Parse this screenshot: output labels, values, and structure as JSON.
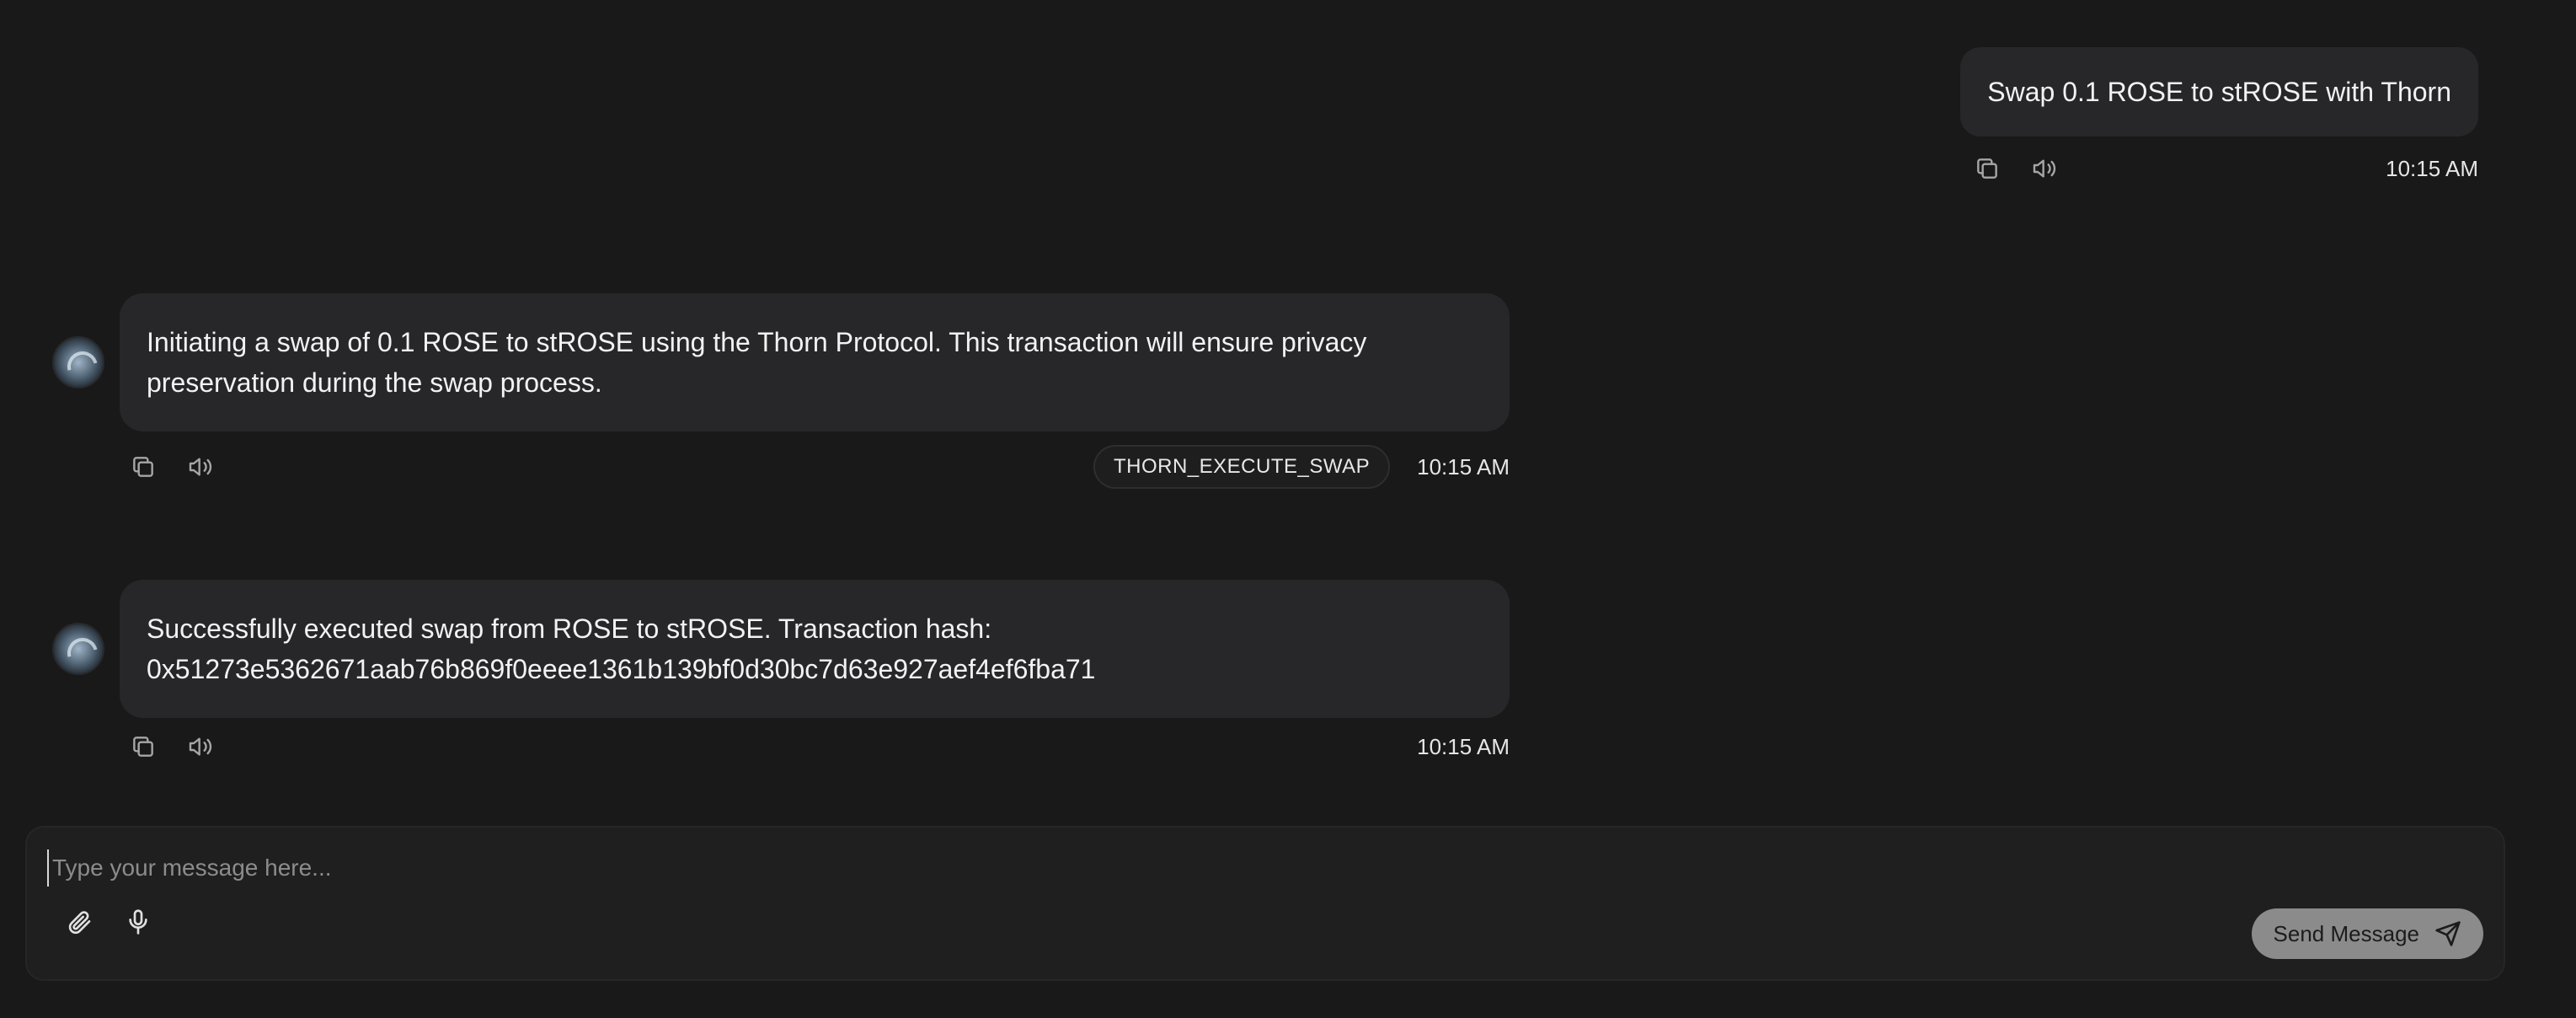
{
  "messages": [
    {
      "role": "user",
      "text": "Swap 0.1 ROSE to stROSE with Thorn",
      "time": "10:15 AM"
    },
    {
      "role": "agent",
      "text": "Initiating a swap of 0.1 ROSE to stROSE using the Thorn Protocol. This transaction will ensure privacy preservation during the swap process.",
      "action": "THORN_EXECUTE_SWAP",
      "time": "10:15 AM"
    },
    {
      "role": "agent",
      "text": "Successfully executed swap from ROSE to stROSE. Transaction hash: 0x51273e5362671aab76b869f0eeee1361b139bf0d30bc7d63e927aef4ef6fba71",
      "time": "10:15 AM"
    }
  ],
  "composer": {
    "placeholder": "Type your message here...",
    "value": "",
    "send_label": "Send Message"
  },
  "icons": {
    "copy": "copy-icon",
    "speaker": "speaker-icon",
    "attach": "paperclip-icon",
    "mic": "microphone-icon",
    "send": "send-icon"
  }
}
